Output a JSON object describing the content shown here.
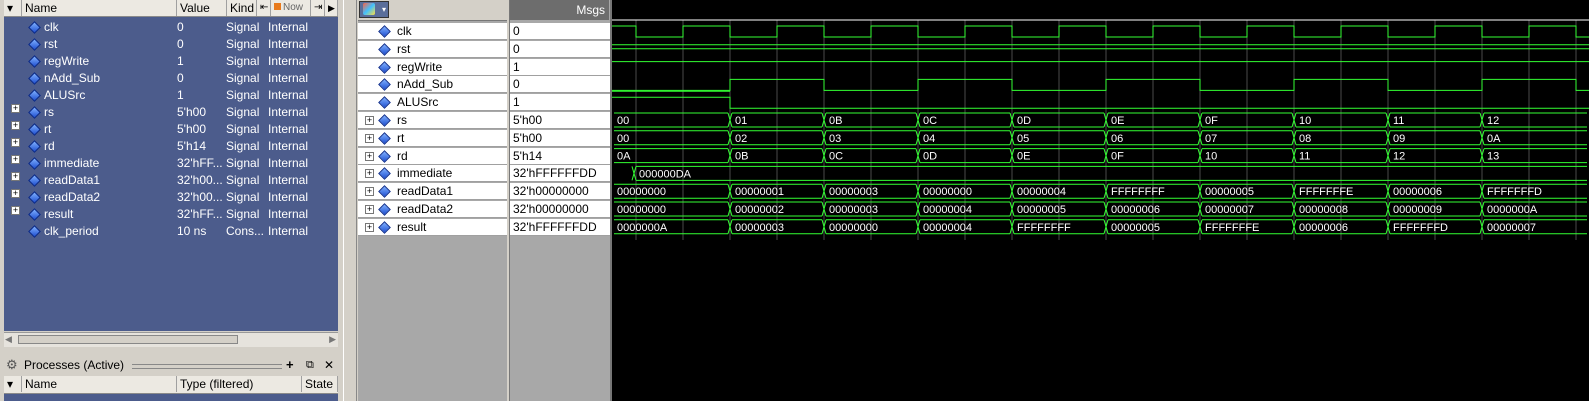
{
  "objects": {
    "header": {
      "name": "Name",
      "value": "Value",
      "kind": "Kind",
      "now": "Now"
    },
    "rows": [
      {
        "name": "clk",
        "value": "0",
        "kind": "Signal",
        "mode": "Internal",
        "expandable": false
      },
      {
        "name": "rst",
        "value": "0",
        "kind": "Signal",
        "mode": "Internal",
        "expandable": false
      },
      {
        "name": "regWrite",
        "value": "1",
        "kind": "Signal",
        "mode": "Internal",
        "expandable": false
      },
      {
        "name": "nAdd_Sub",
        "value": "0",
        "kind": "Signal",
        "mode": "Internal",
        "expandable": false
      },
      {
        "name": "ALUSrc",
        "value": "1",
        "kind": "Signal",
        "mode": "Internal",
        "expandable": false
      },
      {
        "name": "rs",
        "value": "5'h00",
        "kind": "Signal",
        "mode": "Internal",
        "expandable": true
      },
      {
        "name": "rt",
        "value": "5'h00",
        "kind": "Signal",
        "mode": "Internal",
        "expandable": true
      },
      {
        "name": "rd",
        "value": "5'h14",
        "kind": "Signal",
        "mode": "Internal",
        "expandable": true
      },
      {
        "name": "immediate",
        "value": "32'hFF...",
        "kind": "Signal",
        "mode": "Internal",
        "expandable": true
      },
      {
        "name": "readData1",
        "value": "32'h00...",
        "kind": "Signal",
        "mode": "Internal",
        "expandable": true
      },
      {
        "name": "readData2",
        "value": "32'h00...",
        "kind": "Signal",
        "mode": "Internal",
        "expandable": true
      },
      {
        "name": "result",
        "value": "32'hFF...",
        "kind": "Signal",
        "mode": "Internal",
        "expandable": true
      },
      {
        "name": "clk_period",
        "value": "10 ns",
        "kind": "Cons...",
        "mode": "Internal",
        "expandable": false
      }
    ]
  },
  "processes": {
    "title": "Processes (Active)",
    "columns": {
      "name": "Name",
      "type": "Type (filtered)",
      "state": "State"
    }
  },
  "wave": {
    "msgs": "Msgs",
    "signals": [
      {
        "name": "clk",
        "value": "0",
        "bus": false
      },
      {
        "name": "rst",
        "value": "0",
        "bus": false
      },
      {
        "name": "regWrite",
        "value": "1",
        "bus": false
      },
      {
        "name": "nAdd_Sub",
        "value": "0",
        "bus": false
      },
      {
        "name": "ALUSrc",
        "value": "1",
        "bus": false
      },
      {
        "name": "rs",
        "value": "5'h00",
        "bus": true,
        "segments": [
          "00",
          "01",
          "0B",
          "0C",
          "0D",
          "0E",
          "0F",
          "10",
          "11",
          "12"
        ]
      },
      {
        "name": "rt",
        "value": "5'h00",
        "bus": true,
        "segments": [
          "00",
          "02",
          "03",
          "04",
          "05",
          "06",
          "07",
          "08",
          "09",
          "0A"
        ]
      },
      {
        "name": "rd",
        "value": "5'h14",
        "bus": true,
        "segments": [
          "0A",
          "0B",
          "0C",
          "0D",
          "0E",
          "0F",
          "10",
          "11",
          "12",
          "13"
        ]
      },
      {
        "name": "immediate",
        "value": "32'hFFFFFFDD",
        "bus": true,
        "segments": [
          "000000DA"
        ]
      },
      {
        "name": "readData1",
        "value": "32'h00000000",
        "bus": true,
        "segments": [
          "00000000",
          "00000001",
          "00000003",
          "00000000",
          "00000004",
          "FFFFFFFF",
          "00000005",
          "FFFFFFFE",
          "00000006",
          "FFFFFFFD"
        ]
      },
      {
        "name": "readData2",
        "value": "32'h00000000",
        "bus": true,
        "segments": [
          "00000000",
          "00000002",
          "00000003",
          "00000004",
          "00000005",
          "00000006",
          "00000007",
          "00000008",
          "00000009",
          "0000000A"
        ]
      },
      {
        "name": "result",
        "value": "32'hFFFFFFDD",
        "bus": true,
        "segments": [
          "0000000A",
          "00000003",
          "00000000",
          "00000004",
          "FFFFFFFF",
          "00000005",
          "FFFFFFFE",
          "00000006",
          "FFFFFFFD",
          "00000007"
        ]
      }
    ]
  },
  "colors": {
    "wave": "#33ff33",
    "grid": "#4a4a4a",
    "panel": "#4c5c8c",
    "canvas": "#000000"
  }
}
